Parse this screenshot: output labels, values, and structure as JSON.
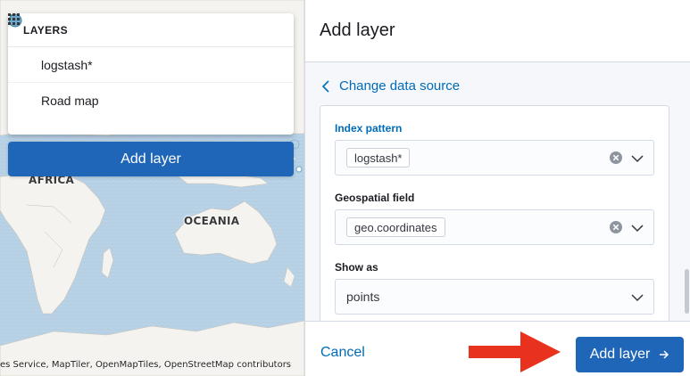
{
  "map": {
    "labels": {
      "africa": "AFRICA",
      "oceania": "OCEANIA"
    },
    "attribution": "es Service, MapTiler, OpenMapTiles, OpenStreetMap contributors"
  },
  "layers_panel": {
    "title": "LAYERS",
    "collapse_icon": "menu-collapse-icon",
    "layers": [
      {
        "name": "logstash*",
        "icon": "circle-marker-icon",
        "icon_color": "#6ba9c6"
      },
      {
        "name": "Road map",
        "icon": "grid-tiles-icon"
      }
    ],
    "add_layer_label": "Add layer"
  },
  "flyout": {
    "title": "Add layer",
    "back_link": "Change data source",
    "fields": {
      "index_pattern": {
        "label": "Index pattern",
        "value": "logstash*"
      },
      "geospatial_field": {
        "label": "Geospatial field",
        "value": "geo.coordinates"
      },
      "show_as": {
        "label": "Show as",
        "value": "points"
      }
    },
    "footer": {
      "cancel_label": "Cancel",
      "submit_label": "Add layer"
    }
  },
  "colors": {
    "primary": "#1f66b8",
    "link": "#006bb8",
    "annotation_arrow": "#e8321d",
    "ocean": "#b9d2e6",
    "land": "#f4f3ef"
  }
}
